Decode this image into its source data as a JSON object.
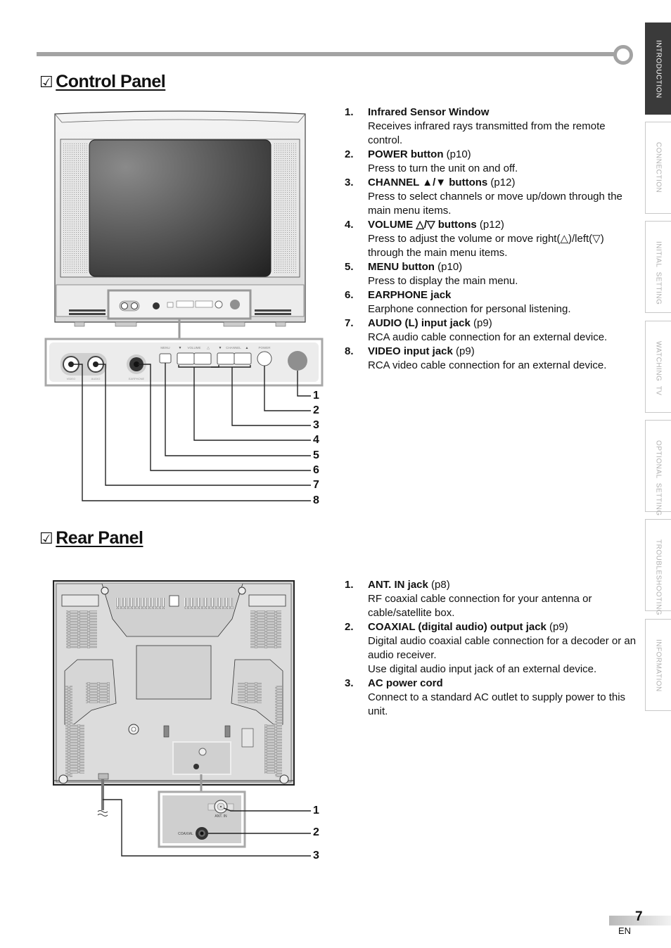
{
  "page": {
    "number": "7",
    "language": "EN"
  },
  "side_tabs": [
    {
      "label": "INTRODUCTION",
      "active": true
    },
    {
      "label": "CONNECTION",
      "active": false
    },
    {
      "label": "INITIAL  SETTING",
      "active": false
    },
    {
      "label": "WATCHING  TV",
      "active": false
    },
    {
      "label": "OPTIONAL  SETTING",
      "active": false
    },
    {
      "label": "TROUBLESHOOTING",
      "active": false
    },
    {
      "label": "INFORMATION",
      "active": false
    }
  ],
  "control_panel": {
    "check_icon": "☑",
    "title": "Control Panel",
    "items": [
      {
        "num": "1.",
        "name": "Infrared Sensor Window",
        "ref": "",
        "desc": "Receives infrared rays transmitted from the remote control."
      },
      {
        "num": "2.",
        "name": "POWER button",
        "ref": " (p10)",
        "desc": "Press to turn the unit on and off."
      },
      {
        "num": "3.",
        "name": "CHANNEL ▲/▼ buttons",
        "ref": " (p12)",
        "desc": "Press to select channels or move up/down through the main menu items."
      },
      {
        "num": "4.",
        "name": "VOLUME △/▽ buttons",
        "ref": " (p12)",
        "desc": "Press to adjust the volume or move right(△)/left(▽) through the main menu items."
      },
      {
        "num": "5.",
        "name": "MENU button",
        "ref": " (p10)",
        "desc": "Press to display the main menu."
      },
      {
        "num": "6.",
        "name": "EARPHONE jack",
        "ref": "",
        "desc": "Earphone connection for personal listening."
      },
      {
        "num": "7.",
        "name": "AUDIO (L) input jack",
        "ref": " (p9)",
        "desc": "RCA audio cable connection for an external device."
      },
      {
        "num": "8.",
        "name": "VIDEO input jack",
        "ref": " (p9)",
        "desc": "RCA video cable connection for an external device."
      }
    ],
    "diagram": {
      "labels": {
        "menu": "MENU",
        "volume": "VOLUME",
        "channel": "CHANNEL",
        "power": "POWER",
        "video": "VIDEO",
        "audio": "AUDIO",
        "earphone": "EARPHONE",
        "down_arrow": "▼",
        "up_arrow": "▲"
      },
      "callouts": [
        "1",
        "2",
        "3",
        "4",
        "5",
        "6",
        "7",
        "8"
      ]
    }
  },
  "rear_panel": {
    "check_icon": "☑",
    "title": "Rear Panel",
    "items": [
      {
        "num": "1.",
        "name": "ANT. IN jack",
        "ref": " (p8)",
        "desc": "RF coaxial cable connection for your antenna or cable/satellite box."
      },
      {
        "num": "2.",
        "name": "COAXIAL (digital audio) output jack",
        "ref": " (p9)",
        "desc": "Digital audio coaxial cable connection for a decoder or an audio receiver.\nUse digital audio input jack of an external device."
      },
      {
        "num": "3.",
        "name": "AC power cord",
        "ref": "",
        "desc": "Connect to a standard AC outlet to supply power to this unit."
      }
    ],
    "diagram": {
      "labels": {
        "ant_in": "ANT. IN",
        "coaxial": "COAXIAL"
      },
      "callouts": [
        "1",
        "2",
        "3"
      ]
    }
  }
}
